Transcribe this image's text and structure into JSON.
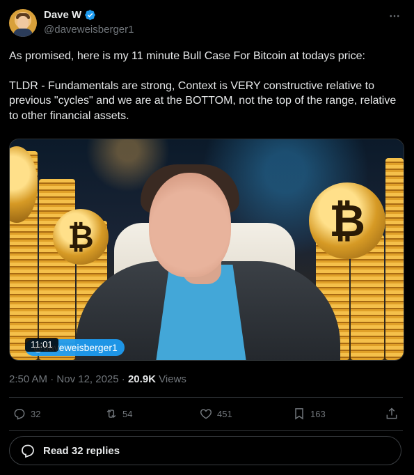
{
  "author": {
    "display_name": "Dave W",
    "handle": "@daveweisberger1"
  },
  "post": {
    "paragraphs": [
      "As promised, here is my 11 minute Bull Case For Bitcoin at todays price:",
      "TLDR - Fundamentals are strong, Context is VERY constructive relative to previous \"cycles\" and we are at the BOTTOM, not the top of the range, relative to other financial assets."
    ]
  },
  "video": {
    "duration": "11:01",
    "badge_handle": "@daveweisberger1"
  },
  "meta": {
    "time": "2:50 AM",
    "separator": " · ",
    "date": "Nov 12, 2025",
    "views_count": "20.9K",
    "views_label": " Views"
  },
  "actions": {
    "replies": "32",
    "reposts": "54",
    "likes": "451",
    "bookmarks": "163"
  },
  "read_replies_label": "Read 32 replies",
  "colors": {
    "background": "#000000",
    "text_primary": "#e7e9ea",
    "text_secondary": "#71767b",
    "verified_blue": "#1d9bf0",
    "border": "#2f3336"
  },
  "icons": [
    "verified-icon",
    "more-icon",
    "reply-icon",
    "repost-icon",
    "like-icon",
    "bookmark-icon",
    "share-icon",
    "read-replies-icon"
  ]
}
